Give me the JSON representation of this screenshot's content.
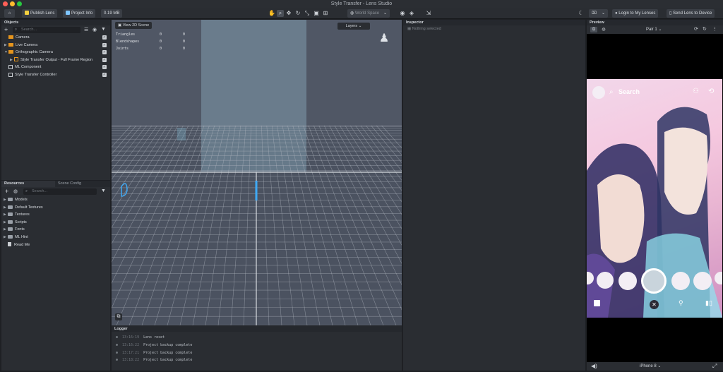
{
  "window": {
    "title": "Style Transfer - Lens Studio"
  },
  "toolbar": {
    "publish_label": "Publish Lens",
    "project_info_label": "Project Info",
    "size_label": "0.19 MB",
    "space_label": "World Space",
    "login_label": "Login to My Lenses",
    "send_label": "Send Lens to Device"
  },
  "objects": {
    "title": "Objects",
    "search_placeholder": "Search...",
    "items": [
      {
        "label": "Camera"
      },
      {
        "label": "Live Camera"
      },
      {
        "label": "Orthographic Camera"
      },
      {
        "label": "Style Transfer Output - Full Frame Region"
      },
      {
        "label": "ML Component"
      },
      {
        "label": "Style Transfer Controller"
      }
    ]
  },
  "resources": {
    "tab_resources": "Resources",
    "tab_scene_config": "Scene Config",
    "search_placeholder": "Search...",
    "items": [
      {
        "label": "Models"
      },
      {
        "label": "Default Textures"
      },
      {
        "label": "Textures"
      },
      {
        "label": "Scripts"
      },
      {
        "label": "Fonts"
      },
      {
        "label": "ML Hint"
      },
      {
        "label": "Read Me"
      }
    ]
  },
  "viewport": {
    "view_2d_label": "View 2D Scene",
    "layers_label": "Layers",
    "stats": [
      {
        "label": "Triangles",
        "a": "0",
        "b": "0"
      },
      {
        "label": "Blendshapes",
        "a": "0",
        "b": "0"
      },
      {
        "label": "Joints",
        "a": "0",
        "b": "0"
      }
    ]
  },
  "logger": {
    "title": "Logger",
    "entries": [
      {
        "time": "13:16:19",
        "msg": "Lens reset"
      },
      {
        "time": "13:16:22",
        "msg": "Project backup complete"
      },
      {
        "time": "13:17:21",
        "msg": "Project backup complete"
      },
      {
        "time": "13:18:22",
        "msg": "Project backup complete"
      }
    ]
  },
  "inspector": {
    "title": "Inspector",
    "empty_text": "Nothing selected"
  },
  "preview": {
    "title": "Preview",
    "pair_label": "Pair 1",
    "search_label": "Search",
    "device_label": "iPhone 8"
  },
  "colors": {
    "accent": "#3fa9f5",
    "publish_icon": "#f4d03f",
    "grid": "#b4bac3"
  }
}
